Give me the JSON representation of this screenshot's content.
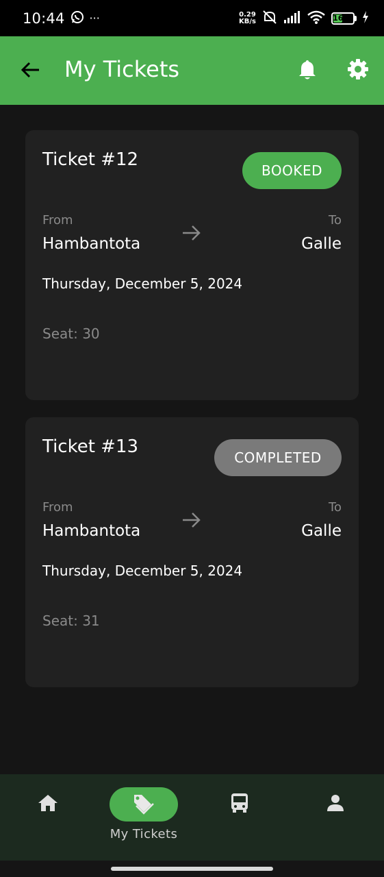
{
  "status_bar": {
    "time": "10:44",
    "more": "···",
    "net_speed_value": "0.29",
    "net_speed_unit": "KB/s",
    "battery": "16"
  },
  "app_bar": {
    "title": "My Tickets",
    "back_icon": "arrow-left-icon",
    "notification_icon": "bell-icon",
    "settings_icon": "gear-icon",
    "color": "#4caf50"
  },
  "tickets": [
    {
      "title": "Ticket #12",
      "status": "BOOKED",
      "status_color": "#4caf50",
      "from_label": "From",
      "from": "Hambantota",
      "to_label": "To",
      "to": "Galle",
      "date": "Thursday, December 5, 2024",
      "seat": "Seat: 30"
    },
    {
      "title": "Ticket #13",
      "status": "COMPLETED",
      "status_color": "#7a7a7a",
      "from_label": "From",
      "from": "Hambantota",
      "to_label": "To",
      "to": "Galle",
      "date": "Thursday, December 5, 2024",
      "seat": "Seat: 31"
    }
  ],
  "bottom_nav": {
    "items": [
      {
        "icon": "home-icon",
        "label": ""
      },
      {
        "icon": "ticket-tag-icon",
        "label": "My Tickets",
        "active": true
      },
      {
        "icon": "bus-icon",
        "label": ""
      },
      {
        "icon": "person-icon",
        "label": ""
      }
    ]
  }
}
